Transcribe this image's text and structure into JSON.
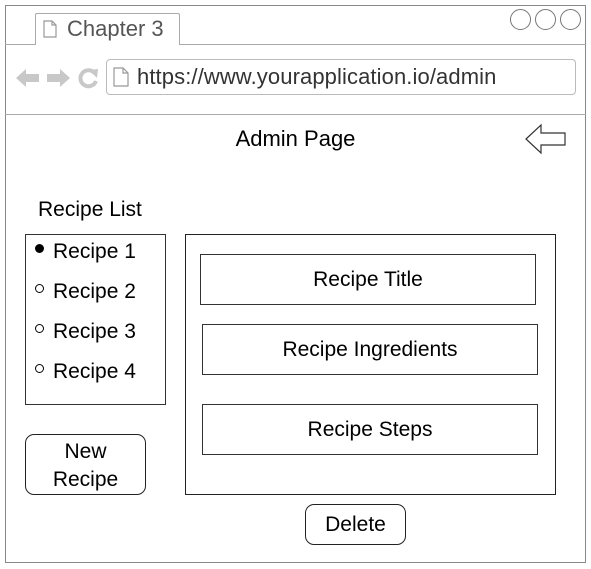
{
  "browser": {
    "tab_title": "Chapter 3",
    "url": "https://www.yourapplication.io/admin"
  },
  "page": {
    "title": "Admin Page"
  },
  "recipe_list": {
    "label": "Recipe List",
    "items": [
      {
        "label": "Recipe 1",
        "selected": true
      },
      {
        "label": "Recipe 2",
        "selected": false
      },
      {
        "label": "Recipe 3",
        "selected": false
      },
      {
        "label": "Recipe 4",
        "selected": false
      }
    ]
  },
  "buttons": {
    "new_recipe_line1": "New",
    "new_recipe_line2": "Recipe",
    "delete": "Delete"
  },
  "editor": {
    "title_field": "Recipe Title",
    "ingredients_field": "Recipe Ingredients",
    "steps_field": "Recipe Steps"
  },
  "icons": {
    "tab": "document-icon",
    "back": "back-arrow-icon",
    "forward": "forward-arrow-icon",
    "reload": "reload-icon",
    "url": "document-icon",
    "page_back": "left-arrow-icon"
  }
}
